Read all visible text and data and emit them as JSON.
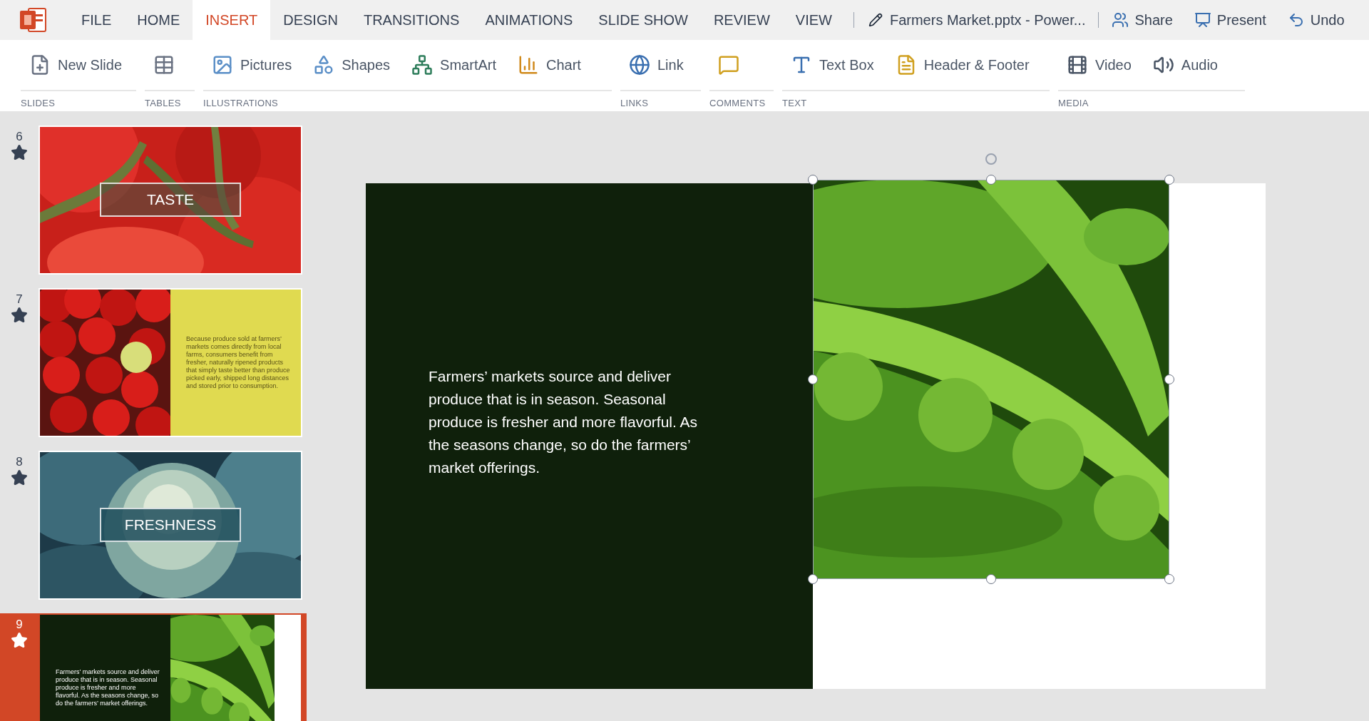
{
  "menu_tabs": [
    {
      "label": "FILE",
      "selected": false
    },
    {
      "label": "HOME",
      "selected": false
    },
    {
      "label": "INSERT",
      "selected": true
    },
    {
      "label": "DESIGN",
      "selected": false
    },
    {
      "label": "TRANSITIONS",
      "selected": false
    },
    {
      "label": "ANIMATIONS",
      "selected": false
    },
    {
      "label": "SLIDE SHOW",
      "selected": false
    },
    {
      "label": "REVIEW",
      "selected": false
    },
    {
      "label": "VIEW",
      "selected": false
    }
  ],
  "document_title": "Farmers Market.pptx - Power...",
  "actions": [
    {
      "label": "Share"
    },
    {
      "label": "Present"
    },
    {
      "label": "Undo"
    }
  ],
  "ribbon": {
    "groups": [
      {
        "label": "SLIDES",
        "items": [
          {
            "kind": "labeled",
            "label": "New Slide"
          }
        ]
      },
      {
        "label": "TABLES",
        "items": [
          {
            "kind": "icon"
          }
        ]
      },
      {
        "label": "ILLUSTRATIONS",
        "items": [
          {
            "kind": "labeled",
            "label": "Pictures"
          },
          {
            "kind": "labeled",
            "label": "Shapes"
          },
          {
            "kind": "labeled",
            "label": "SmartArt"
          },
          {
            "kind": "labeled",
            "label": "Chart"
          }
        ]
      },
      {
        "label": "LINKS",
        "items": [
          {
            "kind": "labeled",
            "label": "Link"
          }
        ]
      },
      {
        "label": "COMMENTS",
        "items": [
          {
            "kind": "icon"
          }
        ]
      },
      {
        "label": "TEXT",
        "items": [
          {
            "kind": "labeled",
            "label": "Text Box"
          },
          {
            "kind": "labeled",
            "label": "Header & Footer"
          }
        ]
      },
      {
        "label": "MEDIA",
        "items": [
          {
            "kind": "labeled",
            "label": "Video"
          },
          {
            "kind": "labeled",
            "label": "Audio"
          }
        ]
      }
    ]
  },
  "slides": [
    {
      "number": "6",
      "selected": false,
      "transition": true,
      "kind": "caption",
      "caption": "TASTE"
    },
    {
      "number": "7",
      "selected": false,
      "transition": true,
      "kind": "split",
      "body": "Because produce sold at farmers’ markets comes directly from local farms, consumers benefit from fresher, naturally ripened products that simply taste better than produce picked early, shipped long distances and stored prior to consumption."
    },
    {
      "number": "8",
      "selected": false,
      "transition": true,
      "kind": "caption",
      "caption": "FRESHNESS"
    },
    {
      "number": "9",
      "selected": true,
      "transition": true,
      "kind": "panel",
      "body": "Farmers’ markets source and deliver produce that is in season. Seasonal produce is fresher and more flavorful. As the seasons change, so do the farmers’ market offerings."
    }
  ],
  "current_slide": {
    "body": "Farmers’ markets source and deliver produce that is in season. Seasonal produce is fresher and more flavorful. As the seasons change, so do the farmers’ market offerings.",
    "image_selected": true
  }
}
